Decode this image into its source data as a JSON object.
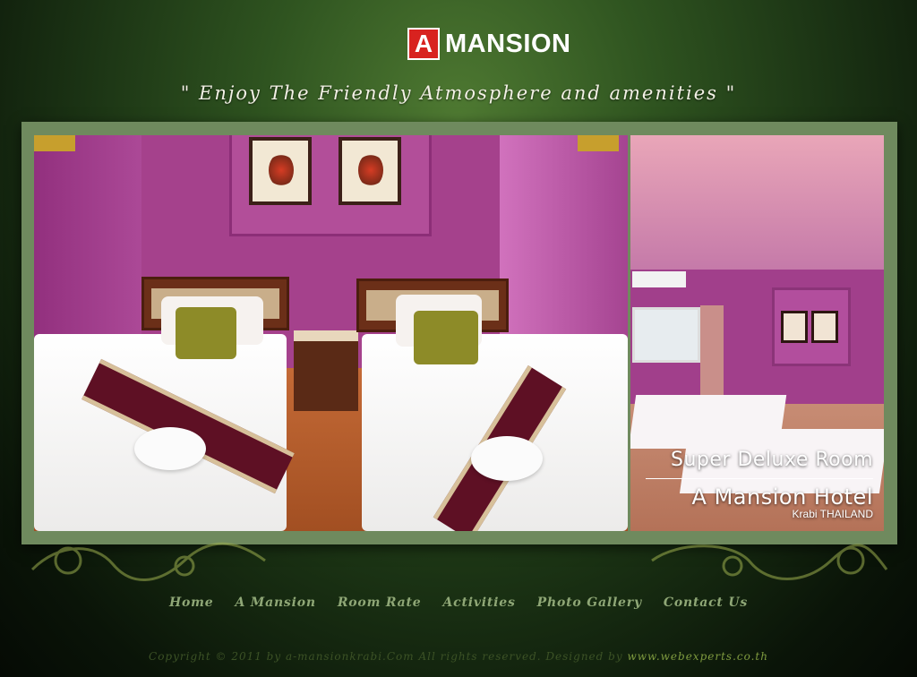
{
  "header": {
    "logo_letter": "A",
    "logo_text": "MANSION",
    "tagline": "\" Enjoy The Friendly Atmosphere and amenities \""
  },
  "hero": {
    "room_name": "Super Deluxe Room",
    "hotel_name": "A Mansion Hotel",
    "location": "Krabi THAILAND"
  },
  "nav": {
    "items": [
      "Home",
      "A Mansion",
      "Room Rate",
      "Activities",
      "Photo Gallery",
      "Contact Us"
    ]
  },
  "footer": {
    "copyright": "Copyright © 2011 by a-mansionkrabi.Com All rights reserved. Designed by ",
    "credit": "www.webexperts.co.th"
  },
  "colors": {
    "logo_red": "#d8221f",
    "nav_text": "#8fa776",
    "footer_text": "#3c5226",
    "credit_text": "#7f9b3f",
    "background_green": "#2f5420"
  }
}
